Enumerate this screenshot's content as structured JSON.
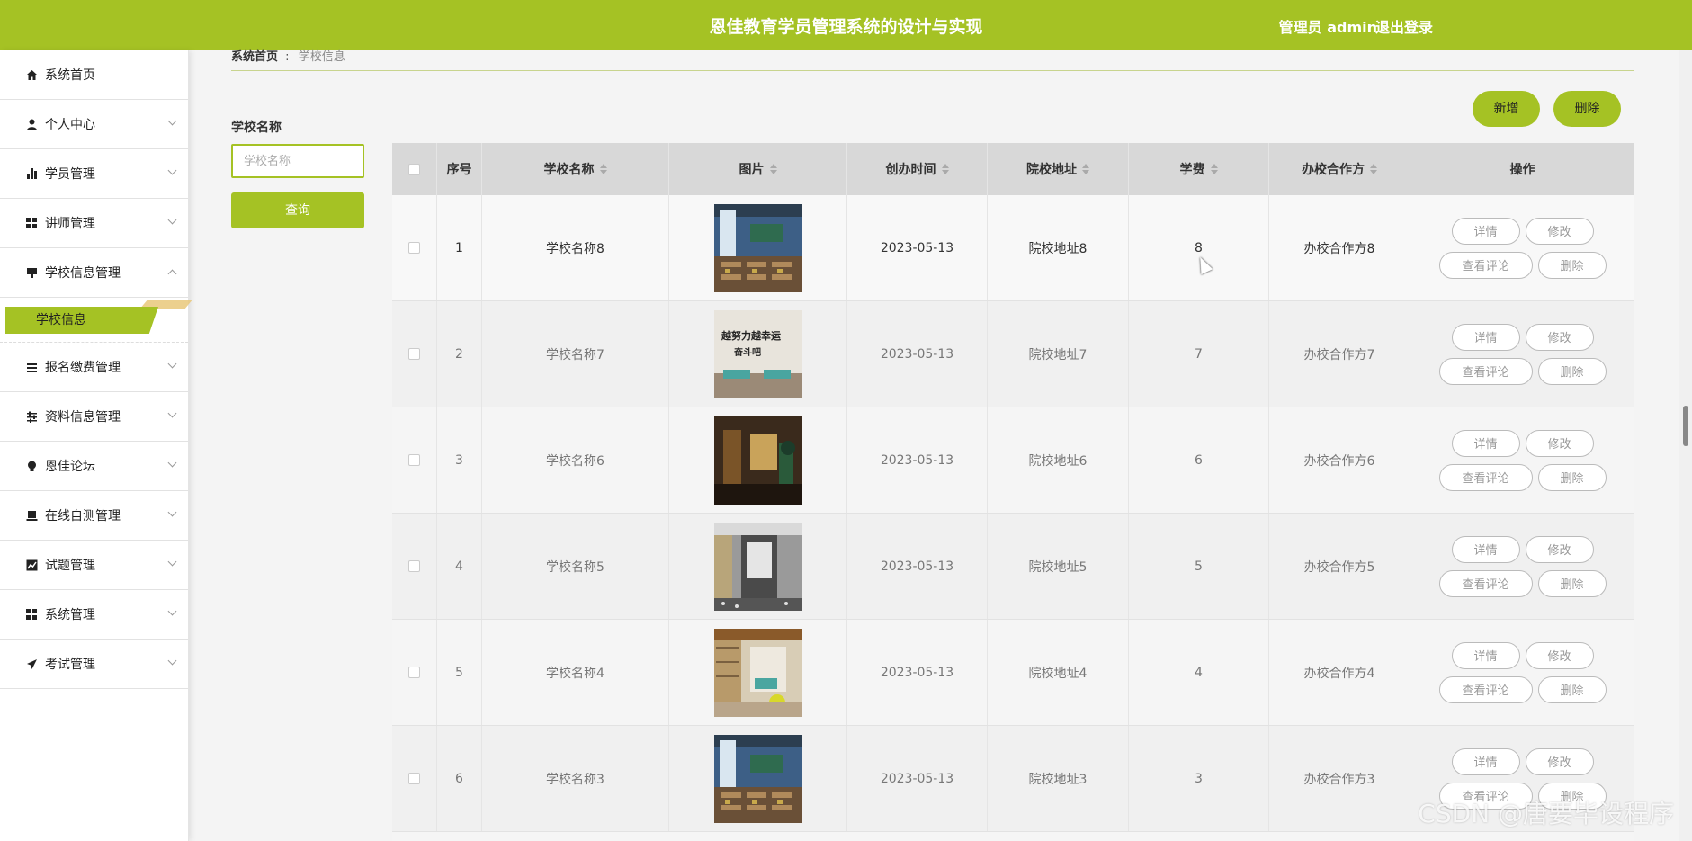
{
  "header": {
    "title": "恩佳教育学员管理系统的设计与实现",
    "admin": "管理员 admin",
    "logout": "退出登录"
  },
  "sidebar": {
    "items": [
      {
        "label": "系统首页",
        "icon": "home-icon"
      },
      {
        "label": "个人中心",
        "icon": "user-icon"
      },
      {
        "label": "学员管理",
        "icon": "bar-chart-icon"
      },
      {
        "label": "讲师管理",
        "icon": "grid-icon"
      },
      {
        "label": "学校信息管理",
        "icon": "monitor-icon"
      },
      {
        "label": "报名缴费管理",
        "icon": "list-icon"
      },
      {
        "label": "资料信息管理",
        "icon": "sliders-icon"
      },
      {
        "label": "恩佳论坛",
        "icon": "bulb-icon"
      },
      {
        "label": "在线自测管理",
        "icon": "laptop-icon"
      },
      {
        "label": "试题管理",
        "icon": "line-chart-icon"
      },
      {
        "label": "系统管理",
        "icon": "grid-icon"
      },
      {
        "label": "考试管理",
        "icon": "send-icon"
      }
    ],
    "submenu_active": "学校信息"
  },
  "breadcrumb": {
    "home": "系统首页",
    "current": "学校信息"
  },
  "search": {
    "label": "学校名称",
    "placeholder": "学校名称",
    "button": "查询"
  },
  "toolbar": {
    "add": "新增",
    "delete": "删除"
  },
  "table": {
    "headers": [
      "序号",
      "学校名称",
      "图片",
      "创办时间",
      "院校地址",
      "学费",
      "办校合作方",
      "操作"
    ],
    "ops": {
      "detail": "详情",
      "edit": "修改",
      "comments": "查看评论",
      "delete": "删除"
    },
    "rows": [
      {
        "no": "1",
        "name": "学校名称8",
        "date": "2023-05-13",
        "addr": "院校地址8",
        "fee": "8",
        "partner": "办校合作方8",
        "img": "classroom-blue"
      },
      {
        "no": "2",
        "name": "学校名称7",
        "date": "2023-05-13",
        "addr": "院校地址7",
        "fee": "7",
        "partner": "办校合作方7",
        "img": "wall-slogan",
        "img_text": "越努力越幸运 奋斗吧"
      },
      {
        "no": "3",
        "name": "学校名称6",
        "date": "2023-05-13",
        "addr": "院校地址6",
        "fee": "6",
        "partner": "办校合作方6",
        "img": "dark-hall"
      },
      {
        "no": "4",
        "name": "学校名称5",
        "date": "2023-05-13",
        "addr": "院校地址5",
        "fee": "5",
        "partner": "办校合作方5",
        "img": "grey-corridor"
      },
      {
        "no": "5",
        "name": "学校名称4",
        "date": "2023-05-13",
        "addr": "院校地址4",
        "fee": "4",
        "partner": "办校合作方4",
        "img": "library-corner"
      },
      {
        "no": "6",
        "name": "学校名称3",
        "date": "2023-05-13",
        "addr": "院校地址3",
        "fee": "3",
        "partner": "办校合作方3",
        "img": "classroom-blue"
      }
    ]
  },
  "watermark": "CSDN @唐要毕设程序",
  "colors": {
    "accent": "#a5c224"
  }
}
